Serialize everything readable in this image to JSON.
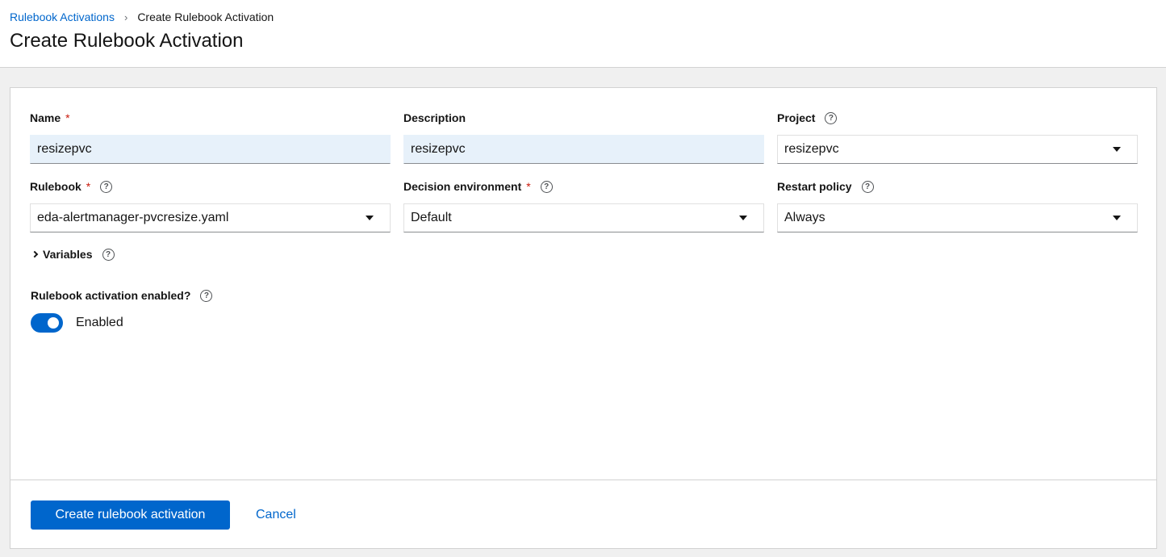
{
  "breadcrumb": {
    "parent": "Rulebook Activations",
    "separator": "›",
    "current": "Create Rulebook Activation"
  },
  "page_title": "Create Rulebook Activation",
  "form": {
    "name": {
      "label": "Name",
      "required_mark": "*",
      "value": "resizepvc"
    },
    "description": {
      "label": "Description",
      "value": "resizepvc"
    },
    "project": {
      "label": "Project",
      "help": "?",
      "value": "resizepvc"
    },
    "rulebook": {
      "label": "Rulebook",
      "required_mark": "*",
      "help": "?",
      "value": "eda-alertmanager-pvcresize.yaml"
    },
    "decision_environment": {
      "label": "Decision environment",
      "required_mark": "*",
      "help": "?",
      "value": "Default"
    },
    "restart_policy": {
      "label": "Restart policy",
      "help": "?",
      "value": "Always"
    },
    "variables": {
      "label": "Variables",
      "help": "?"
    },
    "activation_enabled": {
      "label": "Rulebook activation enabled?",
      "help": "?",
      "state_text": "Enabled",
      "on": true
    }
  },
  "actions": {
    "submit_label": "Create rulebook activation",
    "cancel_label": "Cancel"
  },
  "colors": {
    "primary": "#0066cc",
    "required": "#c9190b",
    "input_filled_bg": "#e7f1fa"
  }
}
